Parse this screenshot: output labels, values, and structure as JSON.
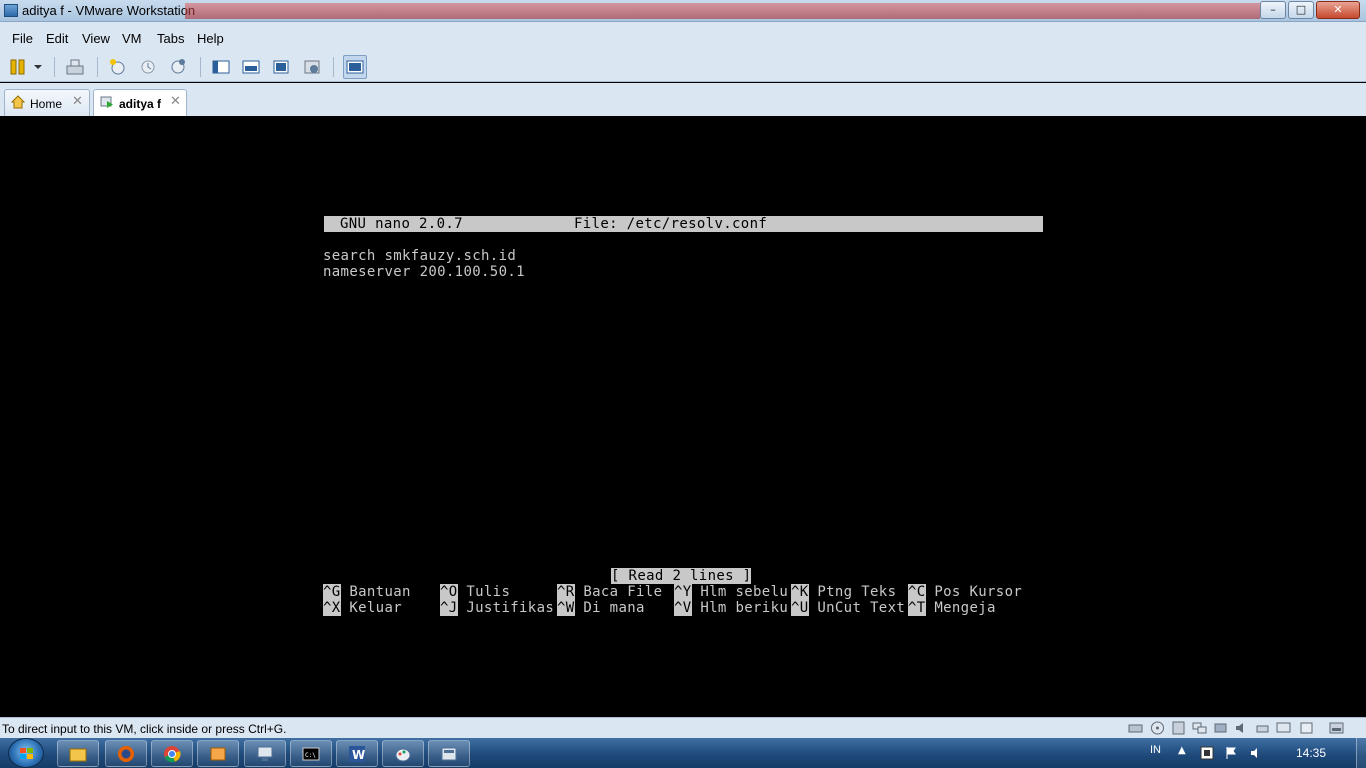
{
  "window": {
    "title": "aditya f - VMware Workstation",
    "controls": [
      "–",
      "□",
      "✕"
    ]
  },
  "menu": {
    "items": [
      "File",
      "Edit",
      "View",
      "VM",
      "Tabs",
      "Help"
    ]
  },
  "toolbar": {
    "icons": [
      "pause-icon",
      "dropdown-arrow-icon",
      "send-ctrl-alt-del-icon",
      "snapshot-take-icon",
      "snapshot-revert-icon",
      "snapshot-manager-icon",
      "console-view-icon",
      "quick-switch-icon",
      "full-screen-icon",
      "unity-icon",
      "thumbnail-bar-icon"
    ]
  },
  "tabs": [
    {
      "label": "Home",
      "icon": "home-icon"
    },
    {
      "label": "aditya f",
      "icon": "vm-running-icon"
    }
  ],
  "nano": {
    "header_version": "GNU nano 2.0.7",
    "header_file": "File: /etc/resolv.conf",
    "lines": [
      "search smkfauzy.sch.id",
      "nameserver 200.100.50.1"
    ],
    "status": "[ Read 2 lines ]",
    "shortcuts_row1": [
      {
        "key": "^G",
        "label": "Bantuan"
      },
      {
        "key": "^O",
        "label": "Tulis"
      },
      {
        "key": "^R",
        "label": "Baca File"
      },
      {
        "key": "^Y",
        "label": "Hlm sebelu"
      },
      {
        "key": "^K",
        "label": "Ptng Teks"
      },
      {
        "key": "^C",
        "label": "Pos Kursor"
      }
    ],
    "shortcuts_row2": [
      {
        "key": "^X",
        "label": "Keluar"
      },
      {
        "key": "^J",
        "label": "Justifikas"
      },
      {
        "key": "^W",
        "label": "Di mana"
      },
      {
        "key": "^V",
        "label": "Hlm beriku"
      },
      {
        "key": "^U",
        "label": "UnCut Text"
      },
      {
        "key": "^T",
        "label": "Mengeja"
      }
    ]
  },
  "statusbar": {
    "message": "To direct input to this VM, click inside or press Ctrl+G."
  },
  "taskbar": {
    "apps": [
      "file-explorer-icon",
      "firefox-icon",
      "chrome-icon",
      "folder-icon",
      "network-icon",
      "cmd-icon",
      "word-icon",
      "paint-icon",
      "vmware-icon"
    ],
    "language": "IN",
    "clock": "14:35"
  }
}
